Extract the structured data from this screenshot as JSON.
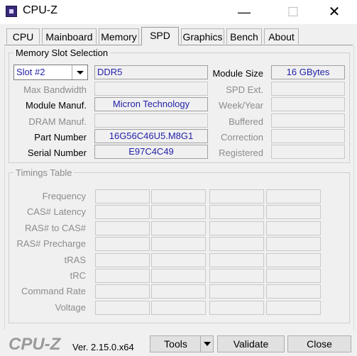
{
  "window": {
    "title": "CPU-Z"
  },
  "titlebar": {
    "minimize": "—",
    "maximize": "☐",
    "close": "✕"
  },
  "tabs": [
    {
      "label": "CPU"
    },
    {
      "label": "Mainboard"
    },
    {
      "label": "Memory"
    },
    {
      "label": "SPD",
      "active": true
    },
    {
      "label": "Graphics"
    },
    {
      "label": "Bench"
    },
    {
      "label": "About"
    }
  ],
  "slot_section": {
    "legend": "Memory Slot Selection",
    "slot_selected": "Slot #2",
    "type": "DDR5",
    "labels": {
      "module_size": "Module Size",
      "max_bandwidth": "Max Bandwidth",
      "spd_ext": "SPD Ext.",
      "module_manuf": "Module Manuf.",
      "week_year": "Week/Year",
      "dram_manuf": "DRAM Manuf.",
      "buffered": "Buffered",
      "part_number": "Part Number",
      "correction": "Correction",
      "serial_number": "Serial Number",
      "registered": "Registered"
    },
    "values": {
      "module_size": "16 GBytes",
      "max_bandwidth": "",
      "spd_ext": "",
      "module_manuf": "Micron Technology",
      "week_year": "",
      "dram_manuf": "",
      "buffered": "",
      "part_number": "16G56C46U5.M8G1",
      "correction": "",
      "serial_number": "E97C4C49",
      "registered": ""
    }
  },
  "timings": {
    "legend": "Timings Table",
    "rows": [
      "Frequency",
      "CAS# Latency",
      "RAS# to CAS#",
      "RAS# Precharge",
      "tRAS",
      "tRC",
      "Command Rate",
      "Voltage"
    ]
  },
  "footer": {
    "logo": "CPU-Z",
    "version": "Ver. 2.15.0.x64",
    "tools": "Tools",
    "validate": "Validate",
    "close": "Close"
  }
}
